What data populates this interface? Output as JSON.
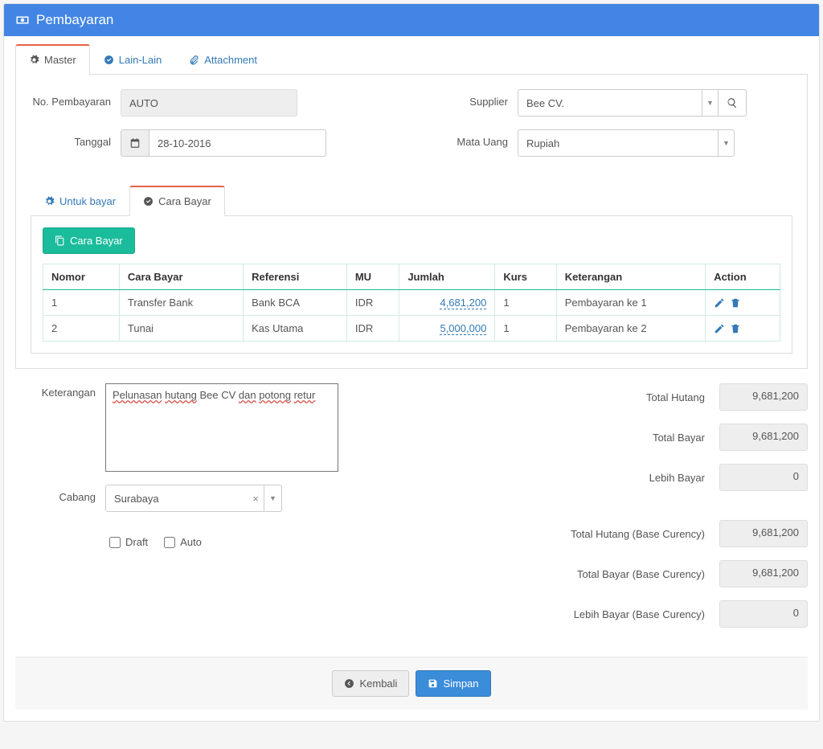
{
  "header": {
    "title": "Pembayaran"
  },
  "tabs": {
    "master": "Master",
    "lainlain": "Lain-Lain",
    "attachment": "Attachment"
  },
  "form": {
    "no_pembayaran_label": "No. Pembayaran",
    "no_pembayaran_value": "AUTO",
    "tanggal_label": "Tanggal",
    "tanggal_value": "28-10-2016",
    "supplier_label": "Supplier",
    "supplier_value": "Bee CV.",
    "matauang_label": "Mata Uang",
    "matauang_value": "Rupiah"
  },
  "inner_tabs": {
    "untuk_bayar": "Untuk bayar",
    "cara_bayar": "Cara Bayar"
  },
  "cara_bayar_btn": "Cara Bayar",
  "table": {
    "headers": {
      "nomor": "Nomor",
      "cara_bayar": "Cara Bayar",
      "referensi": "Referensi",
      "mu": "MU",
      "jumlah": "Jumlah",
      "kurs": "Kurs",
      "keterangan": "Keterangan",
      "action": "Action"
    },
    "rows": [
      {
        "nomor": "1",
        "cara_bayar": "Transfer Bank",
        "referensi": "Bank BCA",
        "mu": "IDR",
        "jumlah": "4,681,200",
        "kurs": "1",
        "keterangan": "Pembayaran ke 1"
      },
      {
        "nomor": "2",
        "cara_bayar": "Tunai",
        "referensi": "Kas Utama",
        "mu": "IDR",
        "jumlah": "5,000,000",
        "kurs": "1",
        "keterangan": "Pembayaran ke 2"
      }
    ]
  },
  "keterangan_label": "Keterangan",
  "keterangan_value": "Pelunasan hutang Bee CV dan potong retur",
  "cabang_label": "Cabang",
  "cabang_value": "Surabaya",
  "checkboxes": {
    "draft": "Draft",
    "auto": "Auto"
  },
  "totals": {
    "total_hutang_label": "Total Hutang",
    "total_hutang_value": "9,681,200",
    "total_bayar_label": "Total Bayar",
    "total_bayar_value": "9,681,200",
    "lebih_bayar_label": "Lebih Bayar",
    "lebih_bayar_value": "0",
    "total_hutang_base_label": "Total Hutang (Base Curency)",
    "total_hutang_base_value": "9,681,200",
    "total_bayar_base_label": "Total Bayar (Base Curency)",
    "total_bayar_base_value": "9,681,200",
    "lebih_bayar_base_label": "Lebih Bayar (Base Curency)",
    "lebih_bayar_base_value": "0"
  },
  "footer": {
    "kembali": "Kembali",
    "simpan": "Simpan"
  }
}
